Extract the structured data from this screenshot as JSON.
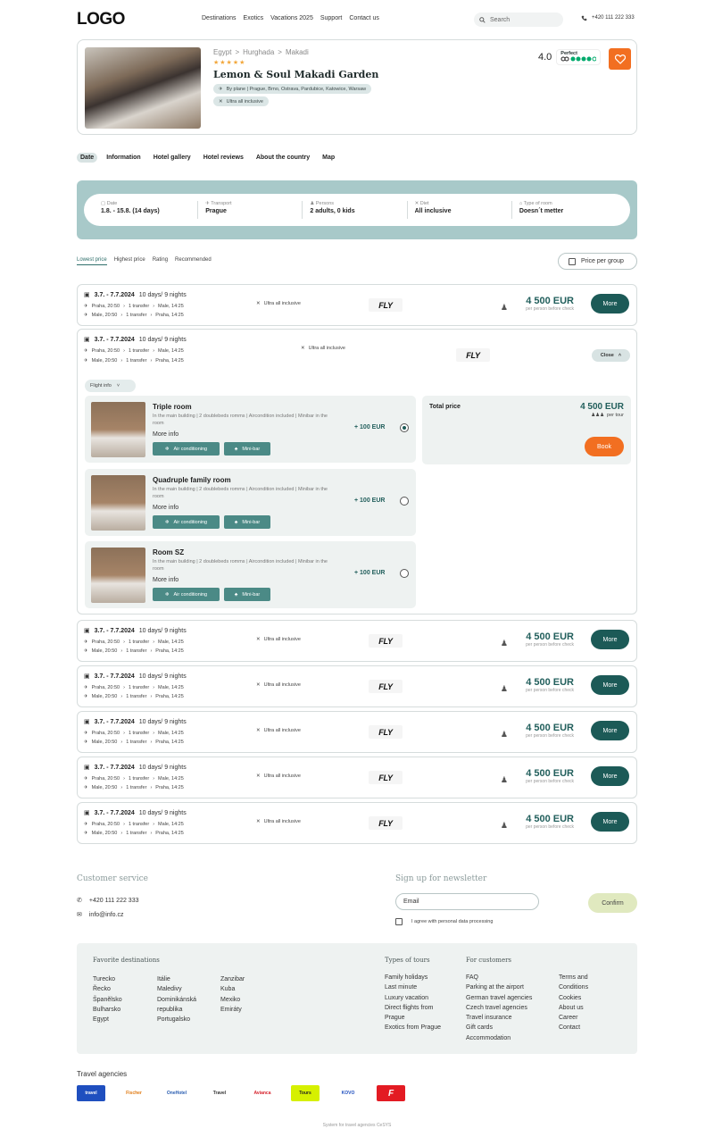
{
  "header": {
    "logo": "LOGO",
    "nav": [
      "Destinations",
      "Exotics",
      "Vacations 2025",
      "Support",
      "Contact us"
    ],
    "search_placeholder": "Search",
    "phone": "+420 111 222 333"
  },
  "hotel": {
    "crumbs": [
      "Egypt",
      ">",
      "Hurghada",
      ">",
      "Makadi"
    ],
    "stars": "★★★★★",
    "name": "Lemon & Soul Makadi Garden",
    "transport": "By plane | Prague, Brno, Ostrava, Pardubice, Katowice, Warsaw",
    "diet": "Ultra all inclusive",
    "rating": "4.0",
    "rating_label": "Perfect"
  },
  "tabs": [
    "Date",
    "Information",
    "Hotel gallery",
    "Hotel reviews",
    "About the country",
    "Map"
  ],
  "filters": [
    {
      "label": "Date",
      "value": "1.8. - 15.8. (14 days)"
    },
    {
      "label": "Transport",
      "value": "Prague"
    },
    {
      "label": "Persons",
      "value": "2 adults, 0 kids"
    },
    {
      "label": "Diet",
      "value": "All inclusive"
    },
    {
      "label": "Type of room",
      "value": "Doesn´t metter"
    }
  ],
  "sorts": [
    "Lowest price",
    "Highest price",
    "Rating",
    "Recommended"
  ],
  "price_per_group": "Price per group",
  "offer": {
    "date": "3.7. - 7.7.2024",
    "duration": "10 days/ 9 nights",
    "leg1_from": "Praha, 20:50",
    "leg1_transfer": "1 transfer",
    "leg1_to": "Male, 14:25",
    "leg2_from": "Male, 20:50",
    "leg2_transfer": "1 transfer",
    "leg2_to": "Praha, 14:25",
    "diet": "Ultra all inclusive",
    "airline": "FLY",
    "price": "4 500 EUR",
    "price_note": "per person before check",
    "more": "More",
    "close": "Close",
    "flight_info": "Flight info"
  },
  "rooms": [
    {
      "name": "Triple room",
      "desc": "In the main building | 2 doublebeds romms | Aircondition included | Minibar in the room",
      "more": "More info",
      "price": "+ 100 EUR",
      "tag1": "Air conditioning",
      "tag2": "Mini-bar"
    },
    {
      "name": "Quadruple family room",
      "desc": "In the main building | 2 doublebeds romms | Aircondition included | Minibar in the room",
      "more": "More info",
      "price": "+ 100 EUR",
      "tag1": "Air conditioning",
      "tag2": "Mini-bar"
    },
    {
      "name": "Room SZ",
      "desc": "In the main building | 2 doublebeds romms | Aircondition included | Minibar in the room",
      "more": "More info",
      "price": "+ 100 EUR",
      "tag1": "Air conditioning",
      "tag2": "Mini-bar"
    }
  ],
  "total": {
    "label": "Total price",
    "price": "4 500 EUR",
    "per": "per tour",
    "book": "Book"
  },
  "footer": {
    "cs_title": "Customer service",
    "phone": "+420 111 222 333",
    "email": "info@info.cz",
    "nl_title": "Sign up for newsletter",
    "email_placeholder": "Email",
    "confirm": "Confirm",
    "agree": "I agree with personal data processing",
    "fav_title": "Favorite destinations",
    "fav1": [
      "Turecko",
      "Řecko",
      "Španělsko",
      "Bulharsko",
      "Egypt"
    ],
    "fav2": [
      "Itálie",
      "Maledivy",
      "Dominikánská",
      "republika",
      "Portugalsko"
    ],
    "fav3": [
      "Zanzibar",
      "Kuba",
      "Mexiko",
      "Emiráty"
    ],
    "types_title": "Types of tours",
    "types": [
      "Family holidays",
      "Last minute",
      "Luxury vacation",
      "Direct flights from",
      "Prague",
      "Exotics from Prague"
    ],
    "cust_title": "For customers",
    "cust": [
      "FAQ",
      "Parking at the airport",
      "German travel agencies",
      "Czech travel agencies",
      "Travel insurance",
      "Gift cards",
      "Accommodation"
    ],
    "cust2": [
      "Terms and",
      "Conditions",
      "Cookies",
      "About us",
      "Career",
      "Contact"
    ],
    "agencies_title": "Travel agencies",
    "agencies": [
      "travel",
      "Fischer",
      "OneHotel",
      "Travel",
      "Avianca",
      "Tours",
      "KOVO",
      "F"
    ],
    "powered": "System for travel agencies CeSYS"
  },
  "colors": {
    "accent": "#1c5a57",
    "orange": "#f26f21",
    "filterbg": "#a8c9c9"
  }
}
